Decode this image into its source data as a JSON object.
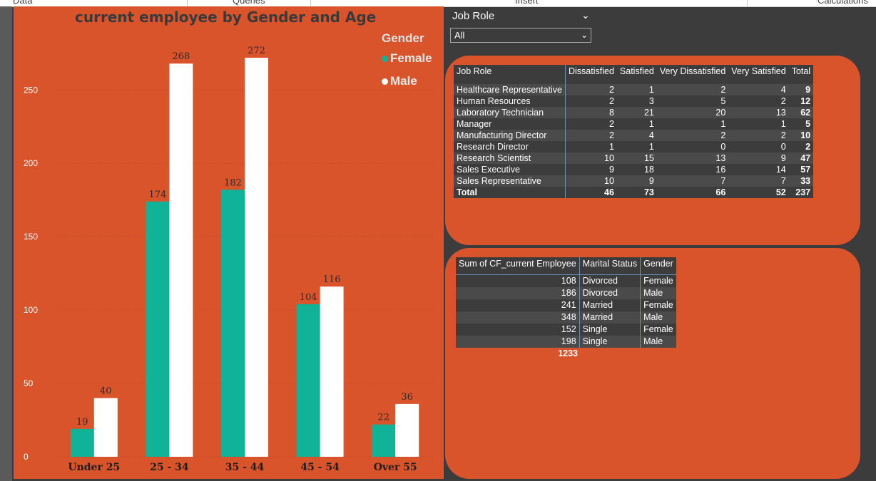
{
  "ribbon": {
    "items": [
      "Data",
      "Queries",
      "Insert",
      "Calculations"
    ]
  },
  "chart_data": {
    "type": "bar",
    "title": "current employee by Gender and Age",
    "legend_title": "Gender",
    "legend_position": "top-right",
    "categories": [
      "Under 25",
      "25 - 34",
      "35 - 44",
      "45 - 54",
      "Over 55"
    ],
    "series": [
      {
        "name": "Female",
        "color": "#10b398",
        "values": [
          19,
          174,
          182,
          104,
          22
        ],
        "labels": [
          "19",
          "174",
          "182",
          "104",
          "22"
        ]
      },
      {
        "name": "Male",
        "color": "#ffffff",
        "values": [
          40,
          268,
          272,
          116,
          36
        ],
        "labels": [
          "40",
          "268",
          "272",
          "116",
          "36"
        ]
      }
    ],
    "yticks": [
      0,
      50,
      100,
      150,
      200,
      250
    ],
    "ytick_labels": [
      "0",
      "50",
      "100",
      "150",
      "200",
      "250"
    ],
    "ylim": [
      0,
      272
    ],
    "grid": true
  },
  "slicer": {
    "title": "Job Role",
    "value": "All"
  },
  "satisfaction_table": {
    "headers": [
      "Job Role",
      "Dissatisfied",
      "Satisfied",
      "Very Dissatisfied",
      "Very Satisfied",
      "Total"
    ],
    "rows": [
      [
        "Healthcare Representative",
        "2",
        "1",
        "2",
        "4",
        "9"
      ],
      [
        "Human Resources",
        "2",
        "3",
        "5",
        "2",
        "12"
      ],
      [
        "Laboratory Technician",
        "8",
        "21",
        "20",
        "13",
        "62"
      ],
      [
        "Manager",
        "2",
        "1",
        "1",
        "1",
        "5"
      ],
      [
        "Manufacturing Director",
        "2",
        "4",
        "2",
        "2",
        "10"
      ],
      [
        "Research Director",
        "1",
        "1",
        "0",
        "0",
        "2"
      ],
      [
        "Research Scientist",
        "10",
        "15",
        "13",
        "9",
        "47"
      ],
      [
        "Sales Executive",
        "9",
        "18",
        "16",
        "14",
        "57"
      ],
      [
        "Sales Representative",
        "10",
        "9",
        "7",
        "7",
        "33"
      ]
    ],
    "total_row": [
      "Total",
      "46",
      "73",
      "66",
      "52",
      "237"
    ]
  },
  "marital_table": {
    "headers": [
      "Sum of CF_current Employee",
      "Marital Status",
      "Gender"
    ],
    "rows": [
      [
        "108",
        "Divorced",
        "Female"
      ],
      [
        "186",
        "Divorced",
        "Male"
      ],
      [
        "241",
        "Married",
        "Female"
      ],
      [
        "348",
        "Married",
        "Male"
      ],
      [
        "152",
        "Single",
        "Female"
      ],
      [
        "198",
        "Single",
        "Male"
      ]
    ],
    "total": "1233"
  },
  "colors": {
    "panel": "#d9532b",
    "canvas": "#3c3c3c",
    "female": "#10b398",
    "male": "#ffffff"
  }
}
